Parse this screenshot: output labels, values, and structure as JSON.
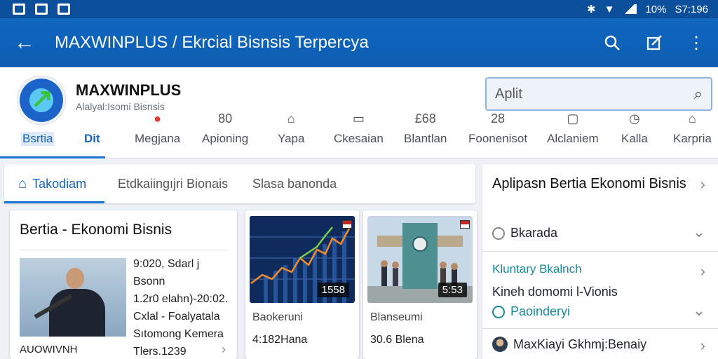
{
  "status": {
    "battery": "10%",
    "time": "S7:196"
  },
  "appbar": {
    "title": "MAXWINPLUS / Ekrcial Bisnsis Terpercya"
  },
  "brand": {
    "name": "MAXWINPLUS",
    "tagline": "Alalyal:Isomi Bisnsis"
  },
  "search": {
    "value": "Aplit"
  },
  "categories": [
    {
      "label": "Bsrtia",
      "icon": ""
    },
    {
      "label": "Dit",
      "icon": ""
    },
    {
      "label": "Megjana",
      "icon": "●"
    },
    {
      "label": "Apioning",
      "icon": "80"
    },
    {
      "label": "Yapa",
      "icon": "⌂"
    },
    {
      "label": "Ckesaian",
      "icon": "▭"
    },
    {
      "label": "Blantlan",
      "icon": "£68"
    },
    {
      "label": "Foonenisot",
      "icon": "28"
    },
    {
      "label": "Alclaniem",
      "icon": "▢"
    },
    {
      "label": "Kalla",
      "icon": "◷"
    },
    {
      "label": "Karpria",
      "icon": "⌂"
    }
  ],
  "tabs": [
    {
      "label": "Takodiam"
    },
    {
      "label": "Etdkaiingıjri Bionais"
    },
    {
      "label": "Slasa banonda"
    }
  ],
  "news": {
    "title": "Bertia - Ekonomi Bisnis",
    "image_caption": "AUOWIVNH",
    "lines": [
      "9:020, Sdarl j Bsonn",
      "1.2r0 elahn)-20:02.",
      "Cxlal - Foalyatala",
      "Sıtomong Kemera",
      "Tlers.1239"
    ]
  },
  "thumbs": [
    {
      "badge": "1558",
      "title": "Baokeruni",
      "meta": "4:182Hana"
    },
    {
      "badge": "5:53",
      "title": "Blanseumi",
      "meta": "30.6 Blena"
    }
  ],
  "right": {
    "title": "Aplipasn Bertia Ekonomi Bisnis",
    "item1": "Bkarada",
    "section_title": "Kluntary Bkalnch",
    "section_sub": "Kineh domomi l-Vionis",
    "section_link": "Paoinderyi",
    "item3": "MaxKiayi Gkhmj:Benaiy"
  },
  "colors": {
    "primary": "#0f66c0",
    "accent": "#1976d2",
    "teal": "#1a8a99"
  }
}
